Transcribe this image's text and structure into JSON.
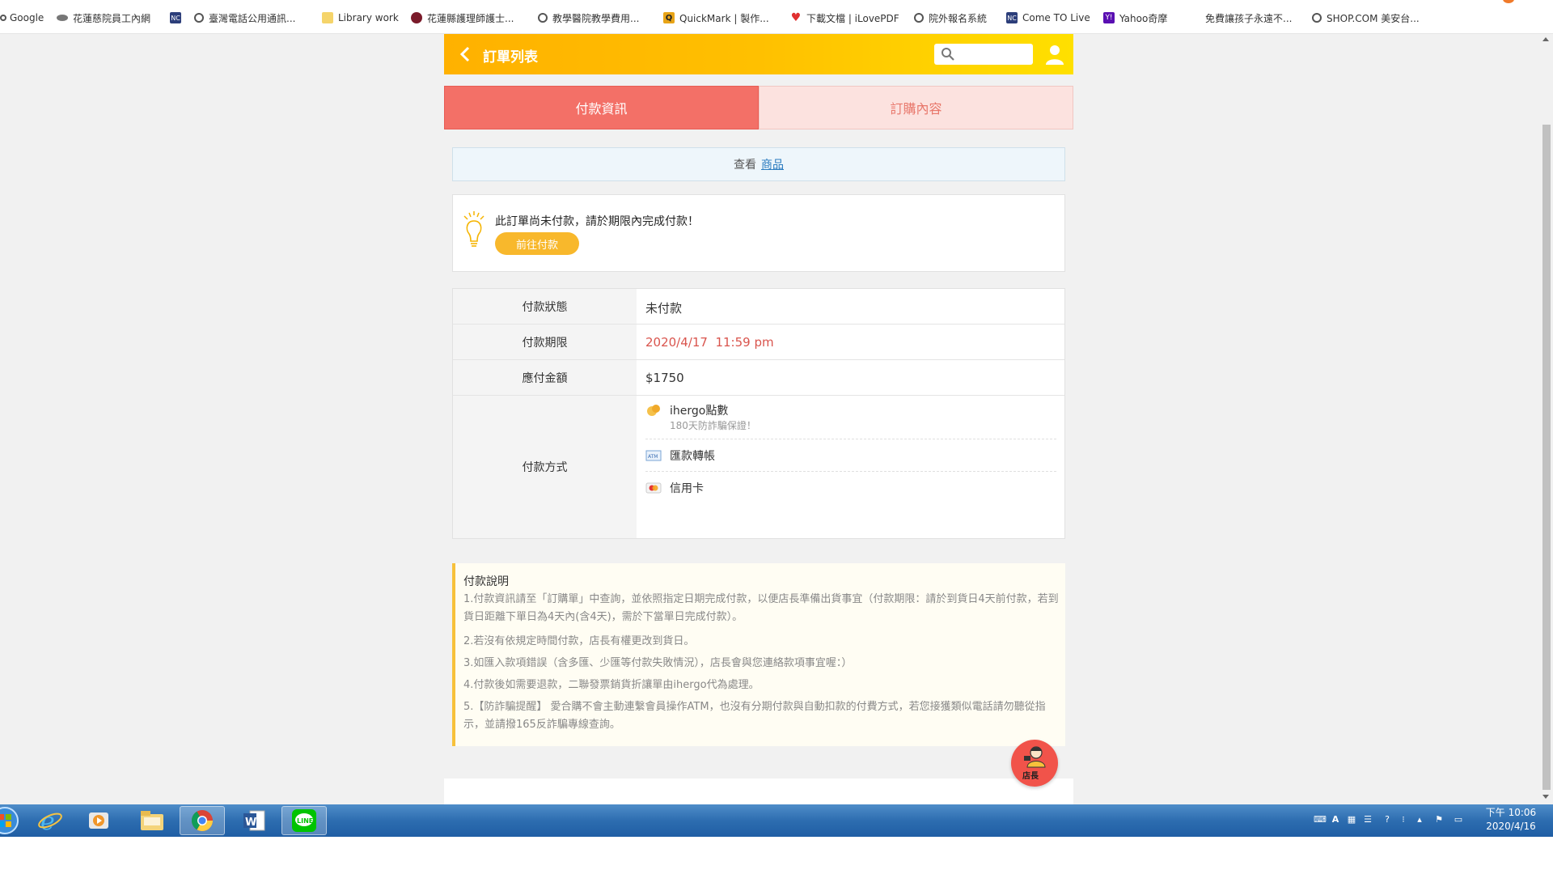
{
  "bookmarks": [
    {
      "label": "Google",
      "icon": "globe-icon"
    },
    {
      "label": "花蓮慈院員工內網",
      "icon": "cloud-icon"
    },
    {
      "label": "",
      "icon": "nc-icon"
    },
    {
      "label": "臺灣電話公用通訊...",
      "icon": "globe-icon"
    },
    {
      "label": "Library work",
      "icon": "folder-icon"
    },
    {
      "label": "花蓮縣護理師護士...",
      "icon": "badge-icon"
    },
    {
      "label": "教學醫院教學費用...",
      "icon": "globe-icon"
    },
    {
      "label": "QuickMark | 製作...",
      "icon": "quickmark-icon"
    },
    {
      "label": "下載文檔 | iLovePDF",
      "icon": "heart-icon"
    },
    {
      "label": "院外報名系統",
      "icon": "globe-icon"
    },
    {
      "label": "Come TO Live",
      "icon": "nc-icon"
    },
    {
      "label": "Yahoo奇摩",
      "icon": "yahoo-icon"
    },
    {
      "label": "免費讓孩子永遠不...",
      "icon": ""
    },
    {
      "label": "SHOP.COM 美安台...",
      "icon": "globe-icon"
    }
  ],
  "header": {
    "title": "訂單列表"
  },
  "tabs": {
    "payment": "付款資訊",
    "order": "訂購內容"
  },
  "view": {
    "prefix": "查看",
    "link": "商品"
  },
  "notice": {
    "message": "此訂單尚未付款，請於期限內完成付款！",
    "button": "前往付款"
  },
  "payment": {
    "status_label": "付款狀態",
    "status_value": "未付款",
    "deadline_label": "付款期限",
    "deadline_value": "2020/4/17  11:59 pm",
    "amount_label": "應付金額",
    "amount_value": "$1750",
    "method_label": "付款方式",
    "methods": [
      {
        "name": "ihergo點數",
        "note": "180天防詐騙保證！",
        "icon": "coin-icon"
      },
      {
        "name": "匯款轉帳",
        "note": "",
        "icon": "atm-icon"
      },
      {
        "name": "信用卡",
        "note": "",
        "icon": "credit-card-icon"
      }
    ]
  },
  "explanation": {
    "title": "付款說明",
    "items": [
      "1.付款資訊請至「訂購單」中查詢，並依照指定日期完成付款，以便店長準備出貨事宜（付款期限：請於到貨日4天前付款，若到貨日距離下單日為4天內(含4天)，需於下當單日完成付款）。",
      "2.若沒有依規定時間付款，店長有權更改到貨日。",
      "3.如匯入款項錯誤（含多匯、少匯等付款失敗情況），店長會與您連絡款項事宜喔：）",
      "4.付款後如需要退款，二聯發票銷貨折讓單由ihergo代為處理。",
      "5.【防詐騙提醒】 愛合購不會主動連繫會員操作ATM，也沒有分期付款與自動扣款的付費方式，若您接獲類似電話請勿聽從指示，並請撥165反詐騙專線查詢。"
    ]
  },
  "store_button": {
    "label": "店長"
  },
  "taskbar": {
    "apps": [
      "ie-icon",
      "media-player-icon",
      "file-explorer-icon",
      "chrome-icon",
      "word-icon",
      "line-icon"
    ],
    "clock_time": "下午 10:06",
    "clock_date": "2020/4/16"
  },
  "colors": {
    "header_gradient_start": "#ffb100",
    "header_gradient_end": "#ffe000",
    "active_tab": "#f37067",
    "inactive_tab": "#fce2df",
    "pay_button": "#f8b82c",
    "deadline_text": "#d9544d",
    "store_button": "#f1534a"
  }
}
